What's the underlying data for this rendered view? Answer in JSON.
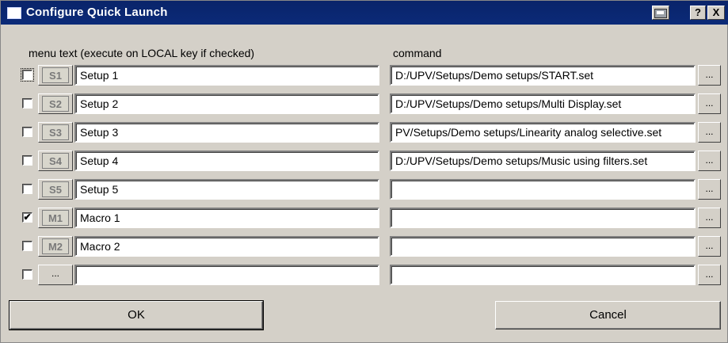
{
  "window": {
    "title": "Configure Quick Launch"
  },
  "titlebar_buttons": {
    "help": "?",
    "close": "X"
  },
  "headers": {
    "menu_text": "menu text (execute on LOCAL key if checked)",
    "command": "command"
  },
  "rows": [
    {
      "checked": false,
      "focused": true,
      "key": "S1",
      "menu": "Setup 1",
      "command": "D:/UPV/Setups/Demo setups/START.set",
      "browse": "..."
    },
    {
      "checked": false,
      "focused": false,
      "key": "S2",
      "menu": "Setup 2",
      "command": "D:/UPV/Setups/Demo setups/Multi Display.set",
      "browse": "..."
    },
    {
      "checked": false,
      "focused": false,
      "key": "S3",
      "menu": "Setup 3",
      "command": "PV/Setups/Demo setups/Linearity analog selective.set",
      "browse": "..."
    },
    {
      "checked": false,
      "focused": false,
      "key": "S4",
      "menu": "Setup 4",
      "command": "D:/UPV/Setups/Demo setups/Music using filters.set",
      "browse": "..."
    },
    {
      "checked": false,
      "focused": false,
      "key": "S5",
      "menu": "Setup 5",
      "command": "",
      "browse": "..."
    },
    {
      "checked": true,
      "focused": false,
      "key": "M1",
      "menu": "Macro 1",
      "command": "",
      "browse": "..."
    },
    {
      "checked": false,
      "focused": false,
      "key": "M2",
      "menu": "Macro 2",
      "command": "",
      "browse": "..."
    },
    {
      "checked": false,
      "focused": false,
      "key": "...",
      "menu": "",
      "command": "",
      "browse": "..."
    }
  ],
  "check_mark": "✔",
  "buttons": {
    "ok": "OK",
    "cancel": "Cancel"
  }
}
